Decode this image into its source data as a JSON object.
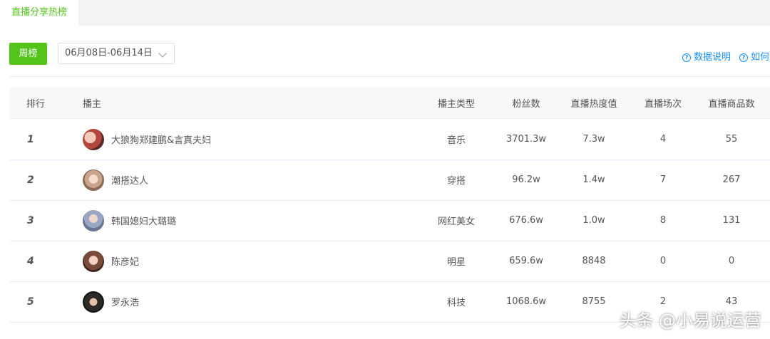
{
  "tab": {
    "label": "直播分享热榜"
  },
  "toolbar": {
    "week_button": "周榜",
    "date_range": "06月08日-06月14日"
  },
  "links": {
    "data_desc": "数据说明",
    "how": "如何"
  },
  "table": {
    "headers": [
      "排行",
      "播主",
      "播主类型",
      "粉丝数",
      "直播热度值",
      "直播场次",
      "直播商品数"
    ],
    "rows": [
      {
        "rank": "1",
        "name": "大狼狗郑建鹏&言真夫妇",
        "type": "音乐",
        "fans": "3701.3w",
        "heat": "7.3w",
        "sessions": "4",
        "products": "55"
      },
      {
        "rank": "2",
        "name": "潮搭达人",
        "type": "穿搭",
        "fans": "96.2w",
        "heat": "1.4w",
        "sessions": "7",
        "products": "267"
      },
      {
        "rank": "3",
        "name": "韩国媳妇大璐璐",
        "type": "网红美女",
        "fans": "676.6w",
        "heat": "1.0w",
        "sessions": "8",
        "products": "131"
      },
      {
        "rank": "4",
        "name": "陈彦妃",
        "type": "明星",
        "fans": "659.6w",
        "heat": "8848",
        "sessions": "0",
        "products": "0"
      },
      {
        "rank": "5",
        "name": "罗永浩",
        "type": "科技",
        "fans": "1068.6w",
        "heat": "8755",
        "sessions": "2",
        "products": "43"
      }
    ]
  },
  "watermark": "头条 @小易说运营",
  "colors": {
    "accent": "#52c41a",
    "link": "#1890ff"
  }
}
